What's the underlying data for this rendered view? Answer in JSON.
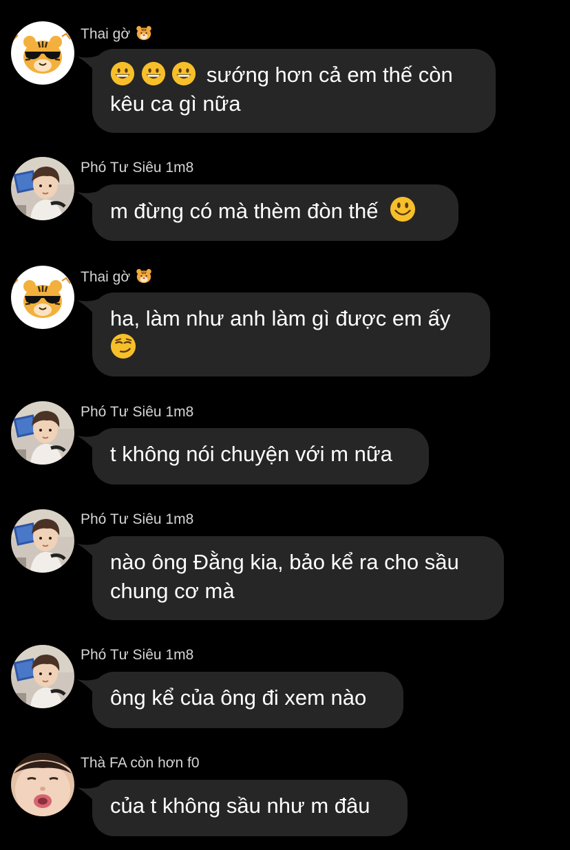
{
  "messages": [
    {
      "sender": "Thai gờ",
      "avatar": "tiger-sunglasses-avatar",
      "sender_emoji": "tiger-face-icon",
      "line1_emojis": [
        "grinning-face-icon",
        "grinning-face-icon",
        "grinning-face-icon"
      ],
      "line1": "sướng hơn cả em thế còn",
      "line2": "kêu ca gì nữa"
    },
    {
      "sender": "Phó Tư Siêu 1m8",
      "avatar": "boy-photo-avatar",
      "line1": "m đừng có mà thèm đòn thế",
      "trailing_emoji": "smiley-face-icon"
    },
    {
      "sender": "Thai gờ",
      "avatar": "tiger-sunglasses-avatar",
      "sender_emoji": "tiger-face-icon",
      "line1": "ha, làm như anh làm gì được em ấy",
      "line2_emoji": "smirking-face-icon"
    },
    {
      "sender": "Phó Tư Siêu 1m8",
      "avatar": "boy-photo-avatar",
      "line1": "t không nói chuyện với m nữa"
    },
    {
      "sender": "Phó Tư Siêu 1m8",
      "avatar": "boy-photo-avatar",
      "line1": "nào ông Đằng kia, bảo kể ra cho sầu",
      "line2": "chung cơ mà"
    },
    {
      "sender": "Phó Tư Siêu 1m8",
      "avatar": "boy-photo-avatar",
      "line1": "ông kể của ông đi xem nào"
    },
    {
      "sender": "Thà FA còn hơn f0",
      "avatar": "kissing-face-photo-avatar",
      "line1": "của t không sầu như m đâu"
    }
  ],
  "colors": {
    "background": "#000000",
    "bubble": "#262626",
    "text": "#ffffff",
    "sender": "#d5d5d5"
  }
}
